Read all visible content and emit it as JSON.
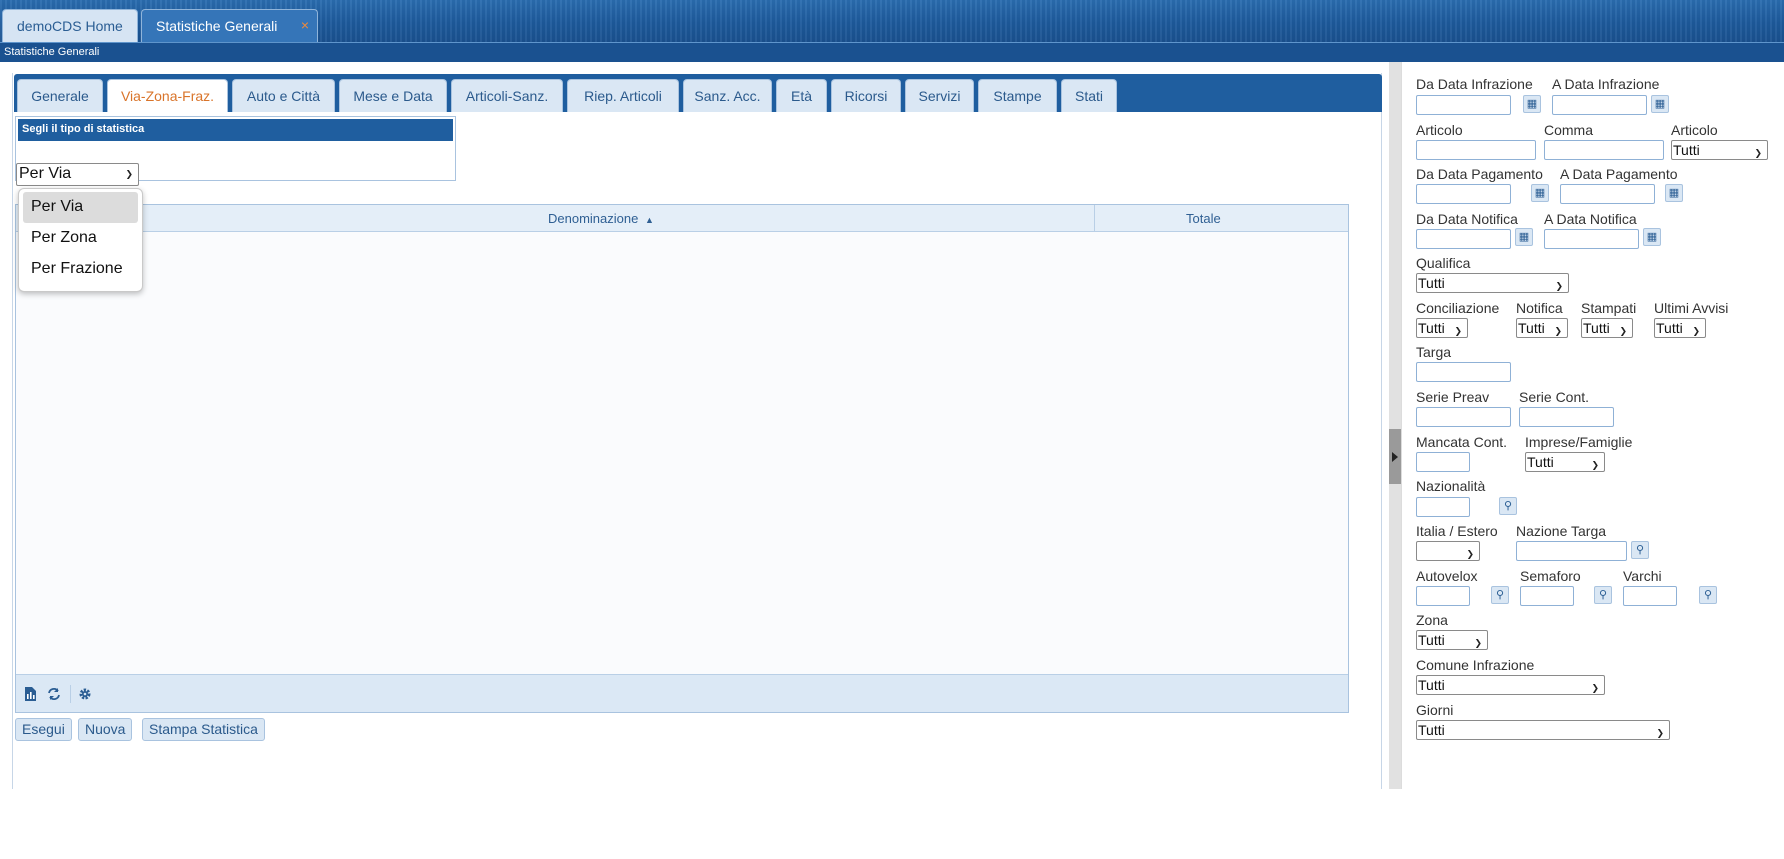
{
  "app_tabs": {
    "home": "demoCDS Home",
    "stat": "Statistiche Generali",
    "close": "×"
  },
  "subtitle": "Statistiche Generali",
  "panel_tabs": [
    "Generale",
    "Via-Zona-Fraz.",
    "Auto e Città",
    "Mese e Data",
    "Articoli-Sanz.",
    "Riep. Articoli",
    "Sanz. Acc.",
    "Età",
    "Ricorsi",
    "Servizi",
    "Stampe",
    "Stati"
  ],
  "chooser": {
    "header": "Segli il tipo di statistica",
    "selected": "Per Via",
    "options": [
      "Per Via",
      "Per Zona",
      "Per Frazione"
    ]
  },
  "grid": {
    "col_denominazione": "Denominazione",
    "col_totale": "Totale",
    "sort_icon": "▲"
  },
  "buttons": {
    "esegui": "Esegui",
    "nuova": "Nuova",
    "stampa": "Stampa Statistica"
  },
  "filters": {
    "da_data_infrazione": "Da Data Infrazione",
    "a_data_infrazione": "A Data Infrazione",
    "articolo": "Articolo",
    "comma": "Comma",
    "articolo2": "Articolo",
    "articolo2_value": "Tutti",
    "da_data_pagamento": "Da Data Pagamento",
    "a_data_pagamento": "A Data Pagamento",
    "da_data_notifica": "Da Data Notifica",
    "a_data_notifica": "A Data Notifica",
    "qualifica": "Qualifica",
    "qualifica_value": "Tutti",
    "conciliazione": "Conciliazione",
    "conciliazione_value": "Tutti",
    "notifica": "Notifica",
    "notifica_value": "Tutti",
    "stampati": "Stampati",
    "stampati_value": "Tutti",
    "ultimi_avvisi": "Ultimi Avvisi",
    "ultimi_avvisi_value": "Tutti",
    "targa": "Targa",
    "serie_preav": "Serie Preav",
    "serie_cont": "Serie Cont.",
    "mancata_cont": "Mancata Cont.",
    "imprese_famiglie": "Imprese/Famiglie",
    "imprese_famiglie_value": "Tutti",
    "nazionalita": "Nazionalità",
    "italia_estero": "Italia / Estero",
    "italia_estero_value": "",
    "nazione_targa": "Nazione Targa",
    "autovelox": "Autovelox",
    "semaforo": "Semaforo",
    "varchi": "Varchi",
    "zona": "Zona",
    "zona_value": "Tutti",
    "comune_infrazione": "Comune Infrazione",
    "comune_infrazione_value": "Tutti",
    "giorni": "Giorni",
    "giorni_value": "Tutti"
  },
  "icons": {
    "calendar": "calendar-icon",
    "search": "search-icon",
    "export": "export-icon",
    "refresh": "refresh-icon",
    "settings": "gear-icon"
  }
}
